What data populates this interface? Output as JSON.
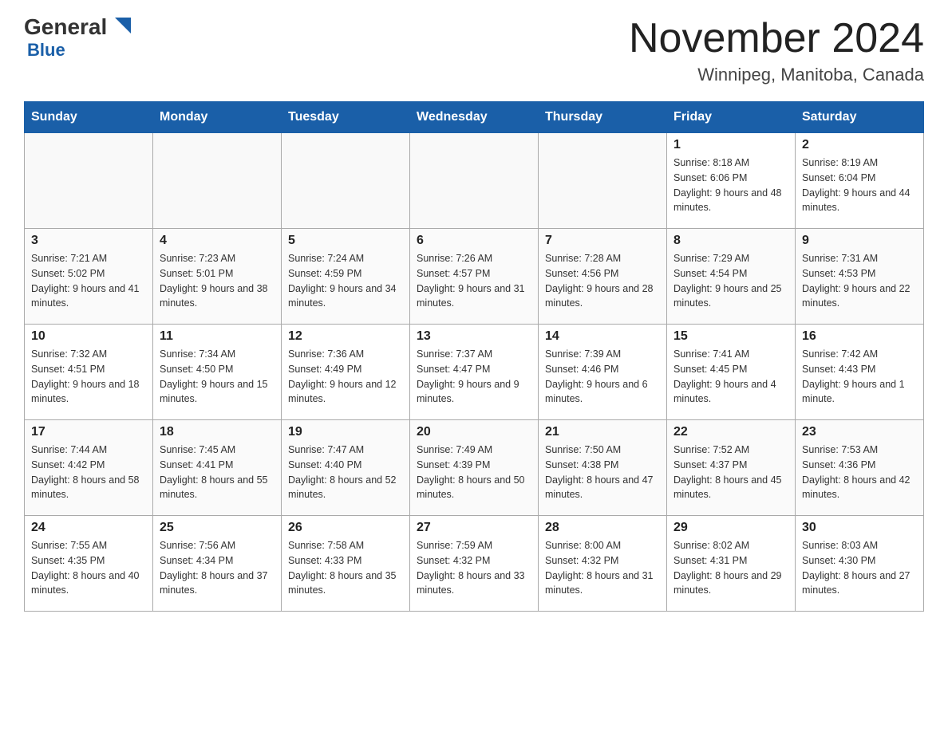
{
  "header": {
    "logo_general": "General",
    "logo_blue": "Blue",
    "title": "November 2024",
    "subtitle": "Winnipeg, Manitoba, Canada"
  },
  "weekdays": [
    "Sunday",
    "Monday",
    "Tuesday",
    "Wednesday",
    "Thursday",
    "Friday",
    "Saturday"
  ],
  "weeks": [
    [
      {
        "day": "",
        "info": ""
      },
      {
        "day": "",
        "info": ""
      },
      {
        "day": "",
        "info": ""
      },
      {
        "day": "",
        "info": ""
      },
      {
        "day": "",
        "info": ""
      },
      {
        "day": "1",
        "info": "Sunrise: 8:18 AM\nSunset: 6:06 PM\nDaylight: 9 hours and 48 minutes."
      },
      {
        "day": "2",
        "info": "Sunrise: 8:19 AM\nSunset: 6:04 PM\nDaylight: 9 hours and 44 minutes."
      }
    ],
    [
      {
        "day": "3",
        "info": "Sunrise: 7:21 AM\nSunset: 5:02 PM\nDaylight: 9 hours and 41 minutes."
      },
      {
        "day": "4",
        "info": "Sunrise: 7:23 AM\nSunset: 5:01 PM\nDaylight: 9 hours and 38 minutes."
      },
      {
        "day": "5",
        "info": "Sunrise: 7:24 AM\nSunset: 4:59 PM\nDaylight: 9 hours and 34 minutes."
      },
      {
        "day": "6",
        "info": "Sunrise: 7:26 AM\nSunset: 4:57 PM\nDaylight: 9 hours and 31 minutes."
      },
      {
        "day": "7",
        "info": "Sunrise: 7:28 AM\nSunset: 4:56 PM\nDaylight: 9 hours and 28 minutes."
      },
      {
        "day": "8",
        "info": "Sunrise: 7:29 AM\nSunset: 4:54 PM\nDaylight: 9 hours and 25 minutes."
      },
      {
        "day": "9",
        "info": "Sunrise: 7:31 AM\nSunset: 4:53 PM\nDaylight: 9 hours and 22 minutes."
      }
    ],
    [
      {
        "day": "10",
        "info": "Sunrise: 7:32 AM\nSunset: 4:51 PM\nDaylight: 9 hours and 18 minutes."
      },
      {
        "day": "11",
        "info": "Sunrise: 7:34 AM\nSunset: 4:50 PM\nDaylight: 9 hours and 15 minutes."
      },
      {
        "day": "12",
        "info": "Sunrise: 7:36 AM\nSunset: 4:49 PM\nDaylight: 9 hours and 12 minutes."
      },
      {
        "day": "13",
        "info": "Sunrise: 7:37 AM\nSunset: 4:47 PM\nDaylight: 9 hours and 9 minutes."
      },
      {
        "day": "14",
        "info": "Sunrise: 7:39 AM\nSunset: 4:46 PM\nDaylight: 9 hours and 6 minutes."
      },
      {
        "day": "15",
        "info": "Sunrise: 7:41 AM\nSunset: 4:45 PM\nDaylight: 9 hours and 4 minutes."
      },
      {
        "day": "16",
        "info": "Sunrise: 7:42 AM\nSunset: 4:43 PM\nDaylight: 9 hours and 1 minute."
      }
    ],
    [
      {
        "day": "17",
        "info": "Sunrise: 7:44 AM\nSunset: 4:42 PM\nDaylight: 8 hours and 58 minutes."
      },
      {
        "day": "18",
        "info": "Sunrise: 7:45 AM\nSunset: 4:41 PM\nDaylight: 8 hours and 55 minutes."
      },
      {
        "day": "19",
        "info": "Sunrise: 7:47 AM\nSunset: 4:40 PM\nDaylight: 8 hours and 52 minutes."
      },
      {
        "day": "20",
        "info": "Sunrise: 7:49 AM\nSunset: 4:39 PM\nDaylight: 8 hours and 50 minutes."
      },
      {
        "day": "21",
        "info": "Sunrise: 7:50 AM\nSunset: 4:38 PM\nDaylight: 8 hours and 47 minutes."
      },
      {
        "day": "22",
        "info": "Sunrise: 7:52 AM\nSunset: 4:37 PM\nDaylight: 8 hours and 45 minutes."
      },
      {
        "day": "23",
        "info": "Sunrise: 7:53 AM\nSunset: 4:36 PM\nDaylight: 8 hours and 42 minutes."
      }
    ],
    [
      {
        "day": "24",
        "info": "Sunrise: 7:55 AM\nSunset: 4:35 PM\nDaylight: 8 hours and 40 minutes."
      },
      {
        "day": "25",
        "info": "Sunrise: 7:56 AM\nSunset: 4:34 PM\nDaylight: 8 hours and 37 minutes."
      },
      {
        "day": "26",
        "info": "Sunrise: 7:58 AM\nSunset: 4:33 PM\nDaylight: 8 hours and 35 minutes."
      },
      {
        "day": "27",
        "info": "Sunrise: 7:59 AM\nSunset: 4:32 PM\nDaylight: 8 hours and 33 minutes."
      },
      {
        "day": "28",
        "info": "Sunrise: 8:00 AM\nSunset: 4:32 PM\nDaylight: 8 hours and 31 minutes."
      },
      {
        "day": "29",
        "info": "Sunrise: 8:02 AM\nSunset: 4:31 PM\nDaylight: 8 hours and 29 minutes."
      },
      {
        "day": "30",
        "info": "Sunrise: 8:03 AM\nSunset: 4:30 PM\nDaylight: 8 hours and 27 minutes."
      }
    ]
  ]
}
